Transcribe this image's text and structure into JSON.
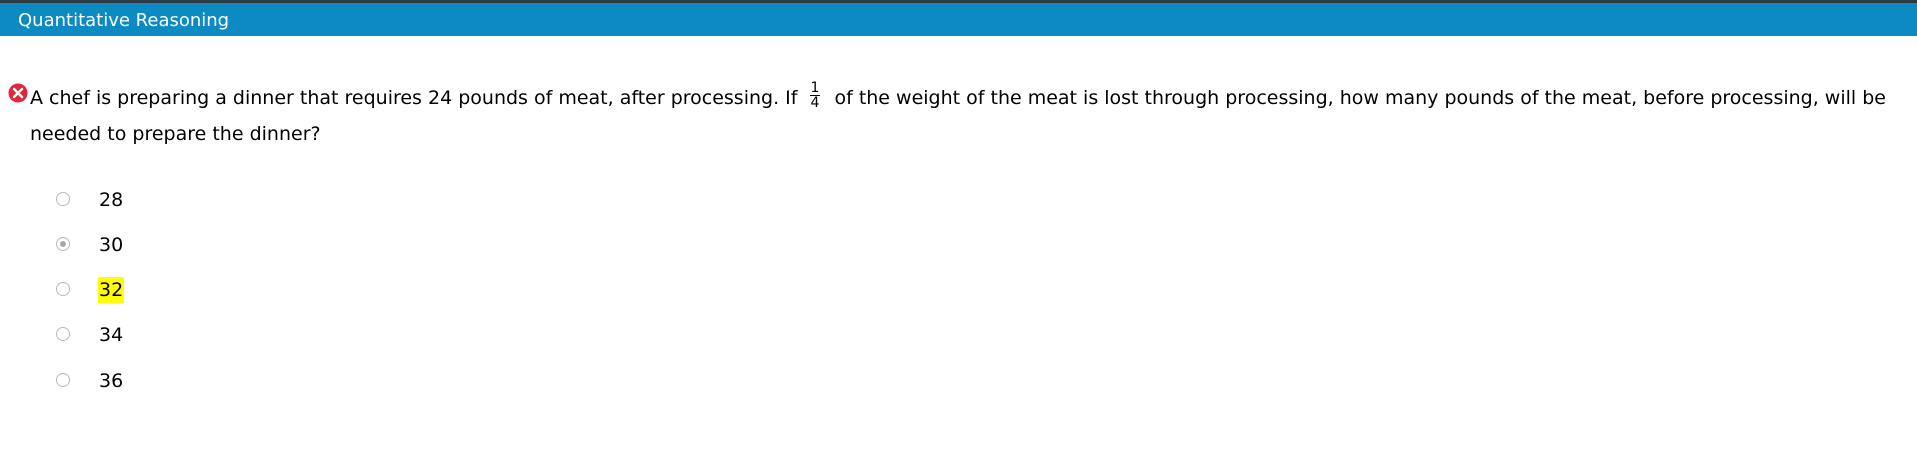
{
  "header": {
    "title": "Quantitative Reasoning",
    "bar_color": "#0b8bc2"
  },
  "question": {
    "status_icon": "incorrect-x-icon",
    "status_color": "#e0283a",
    "text_before": "A chef is preparing a dinner that requires 24 pounds of meat, after processing. If",
    "fraction_numerator": "1",
    "fraction_denominator": "4",
    "text_after": "of the weight of the meat is lost through processing, how many pounds of the meat, before processing, will be needed to prepare the dinner?"
  },
  "options": [
    {
      "label": "28",
      "selected": false,
      "highlighted": false
    },
    {
      "label": "30",
      "selected": true,
      "highlighted": false
    },
    {
      "label": "32",
      "selected": false,
      "highlighted": true
    },
    {
      "label": "34",
      "selected": false,
      "highlighted": false
    },
    {
      "label": "36",
      "selected": false,
      "highlighted": false
    }
  ],
  "highlight_color": "#ffff00"
}
